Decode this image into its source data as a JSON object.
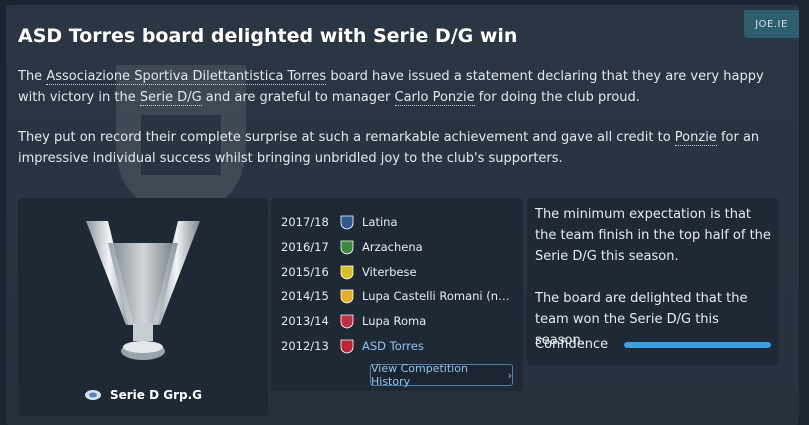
{
  "badge": "JOE.IE",
  "title": "ASD Torres board delighted with Serie D/G win",
  "para1": {
    "t1": "The ",
    "club_full": "Associazione Sportiva Dilettantistica Torres",
    "t2": " board have issued a statement declaring that they are very happy with victory in the ",
    "competition": "Serie D/G",
    "t3": " and are grateful to manager ",
    "manager": "Carlo Ponzie",
    "t4": " for doing the club proud."
  },
  "para2": {
    "t1": "They put on record their complete surprise at such a remarkable achievement and gave all credit to ",
    "manager_short": "Ponzie",
    "t2": " for an impressive individual success whilst bringing unbridled joy to the club's supporters."
  },
  "trophy": {
    "competition_name": "Serie D Grp.G",
    "icon": "trophy-icon"
  },
  "history": {
    "rows": [
      {
        "season": "2017/18",
        "team": "Latina",
        "color": "#2c5a8c"
      },
      {
        "season": "2016/17",
        "team": "Arzachena",
        "color": "#3b8a3a"
      },
      {
        "season": "2015/16",
        "team": "Viterbese",
        "color": "#d8c020"
      },
      {
        "season": "2014/15",
        "team": "Lupa Castelli Romani (no l...",
        "color": "#e0b020"
      },
      {
        "season": "2013/14",
        "team": "Lupa Roma",
        "color": "#c03040"
      },
      {
        "season": "2012/13",
        "team": "ASD Torres",
        "color": "#c02030"
      }
    ],
    "button_label": "View Competition History"
  },
  "board": {
    "expectation": "The minimum expectation is that the team finish in the top half of the Serie D/G this season.",
    "verdict": "The board are delighted that the team won the Serie D/G this season.",
    "confidence_label": "Confidence",
    "confidence_level": 1.0
  }
}
